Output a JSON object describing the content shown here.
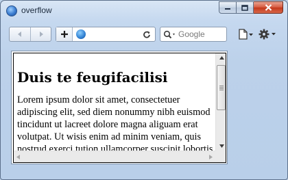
{
  "window": {
    "title": "overflow"
  },
  "toolbar": {
    "search_placeholder": "Google"
  },
  "page": {
    "heading": "Duis te feugifacilisi",
    "paragraph": "Lorem ipsum dolor sit amet, consectetuer adipiscing elit, sed diem nonummy nibh euismod tincidunt ut lacreet dolore magna aliguam erat volutpat. Ut wisis enim ad minim veniam, quis nostrud exerci tution ullamcorper suscipit lobortis nisl ut aliquip ex ea commodo consequat."
  },
  "icons": {
    "app": "browser-globe-icon",
    "back": "back-arrow-icon",
    "forward": "forward-arrow-icon",
    "add_tab": "plus-icon",
    "site": "globe-icon",
    "reload": "reload-icon",
    "search": "search-icon",
    "page_menu": "page-icon",
    "settings": "gear-icon"
  },
  "colors": {
    "window_frame": "#bcd1ea",
    "close_button": "#c3381b"
  }
}
